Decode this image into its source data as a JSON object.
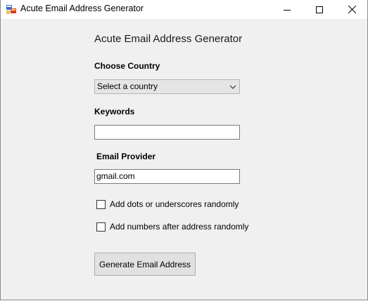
{
  "window": {
    "title": "Acute Email Address Generator",
    "icon": "app-window-icon",
    "controls": {
      "minimize_icon": "minimize-icon",
      "maximize_icon": "maximize-icon",
      "close_icon": "close-icon"
    }
  },
  "form": {
    "heading": "Acute Email Address Generator",
    "country": {
      "label": "Choose Country",
      "selected": "Select a country",
      "icon": "chevron-down-icon"
    },
    "keywords": {
      "label": "Keywords",
      "value": ""
    },
    "provider": {
      "label": "Email Provider",
      "value": "gmail.com"
    },
    "options": [
      {
        "label": "Add dots or underscores randomly",
        "checked": false
      },
      {
        "label": "Add numbers after address randomly",
        "checked": false
      }
    ],
    "generate_button": "Generate Email Address"
  },
  "colors": {
    "window_bg": "#f0f0f0",
    "titlebar_bg": "#ffffff",
    "button_bg": "#e1e1e1",
    "select_bg": "#e5e5e5"
  }
}
